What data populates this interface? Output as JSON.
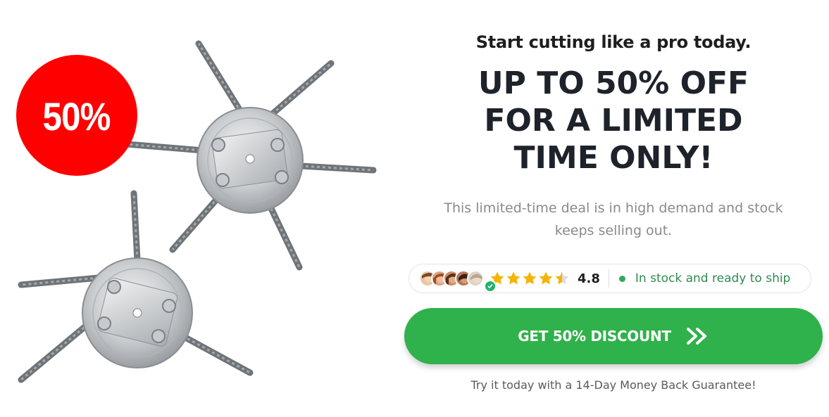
{
  "badge": {
    "text": "50%",
    "color": "#ff0000"
  },
  "tagline": "Start cutting like a pro today.",
  "headline": {
    "line1": "UP TO 50% OFF",
    "line2": "FOR A LIMITED",
    "line3": "TIME ONLY!"
  },
  "description": {
    "line1": "This limited-time deal is in high demand and stock",
    "line2": "keeps selling out."
  },
  "trust": {
    "stars_filled": 4.5,
    "stars_total": 5,
    "rating": "4.8",
    "stock_text": "In stock and ready to ship",
    "stock_color": "#33a85c",
    "star_color": "#f5b400"
  },
  "cta": {
    "label": "GET 50% DISCOUNT",
    "icon": "double-chevron-right-icon",
    "color": "#2fb14b"
  },
  "guarantee": "Try it today with a 14-Day Money Back Guarantee!"
}
